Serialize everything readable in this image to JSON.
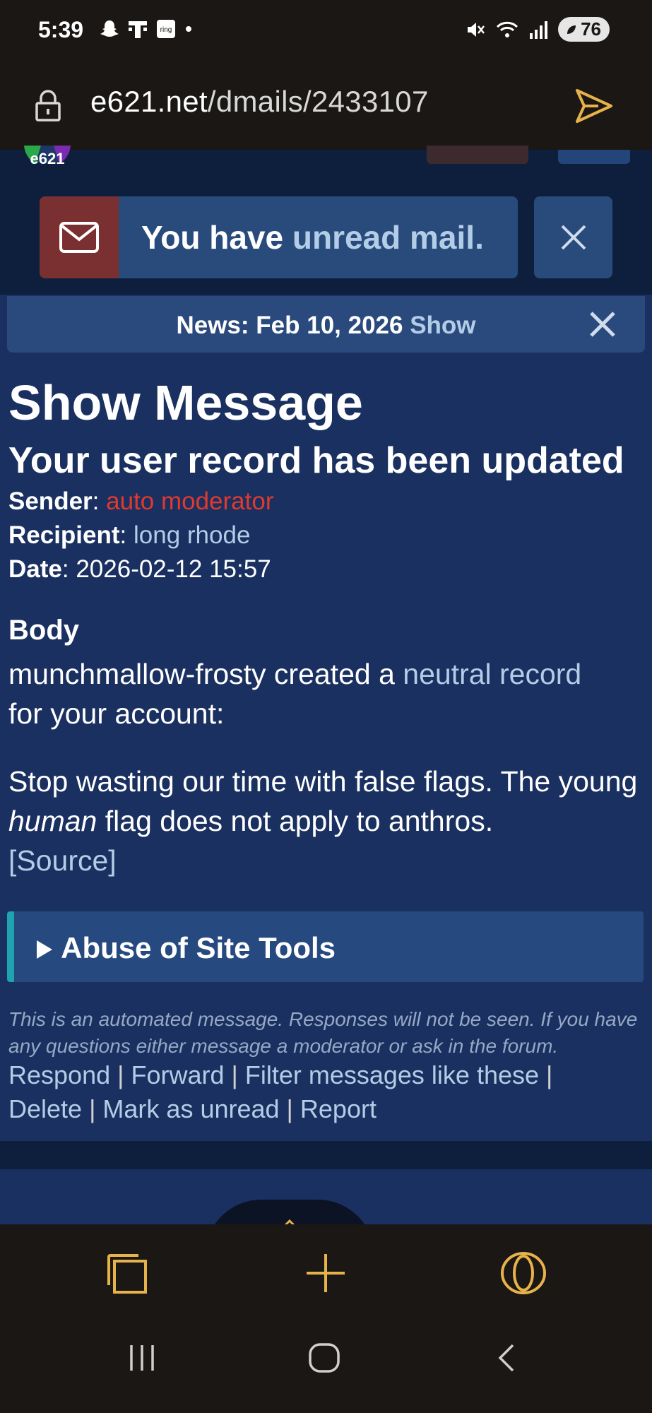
{
  "status_bar": {
    "time": "5:39",
    "battery": "76"
  },
  "url_bar": {
    "host": "e621.net",
    "path": "/dmails/2433107"
  },
  "mail_notice": {
    "prefix": "You have ",
    "link": "unread mail."
  },
  "news": {
    "label": "News: Feb 10, 2026",
    "show": "Show"
  },
  "page_title": "Show Message",
  "message": {
    "subject": "Your user record has been updated",
    "sender_label": "Sender",
    "sender": "auto moderator",
    "recipient_label": "Recipient",
    "recipient": "long rhode",
    "date_label": "Date",
    "date": "2026-02-12 15:57",
    "body_label": "Body",
    "body_line1_prefix": "munchmallow-frosty created a ",
    "body_line1_link": "neutral record",
    "body_line1_suffix": "for your account:",
    "body_p2_a": "Stop wasting our time with false flags. The young ",
    "body_p2_italic": "human",
    "body_p2_b": " flag does not apply to anthros.",
    "source_link": "[Source]",
    "collapsible": "Abuse of Site Tools",
    "automated_notice": "This is an automated message. Responses will not be seen. If you have any questions either message a moderator or ask in the forum."
  },
  "actions": {
    "respond": "Respond",
    "forward": "Forward",
    "filter": "Filter messages like these",
    "delete": "Delete",
    "mark_unread": "Mark as unread",
    "report": "Report",
    "separator": " | "
  },
  "colors": {
    "accent_gold": "#e8b24a",
    "link_light": "#b4cde6",
    "sender_red": "#e0392d",
    "page_bg": "#1a3060"
  },
  "icons": {
    "lock": "lock-icon",
    "send": "send-icon",
    "mail": "mail-icon",
    "close": "close-icon",
    "tabs": "tabs-icon",
    "plus": "plus-icon",
    "opera": "opera-icon"
  }
}
